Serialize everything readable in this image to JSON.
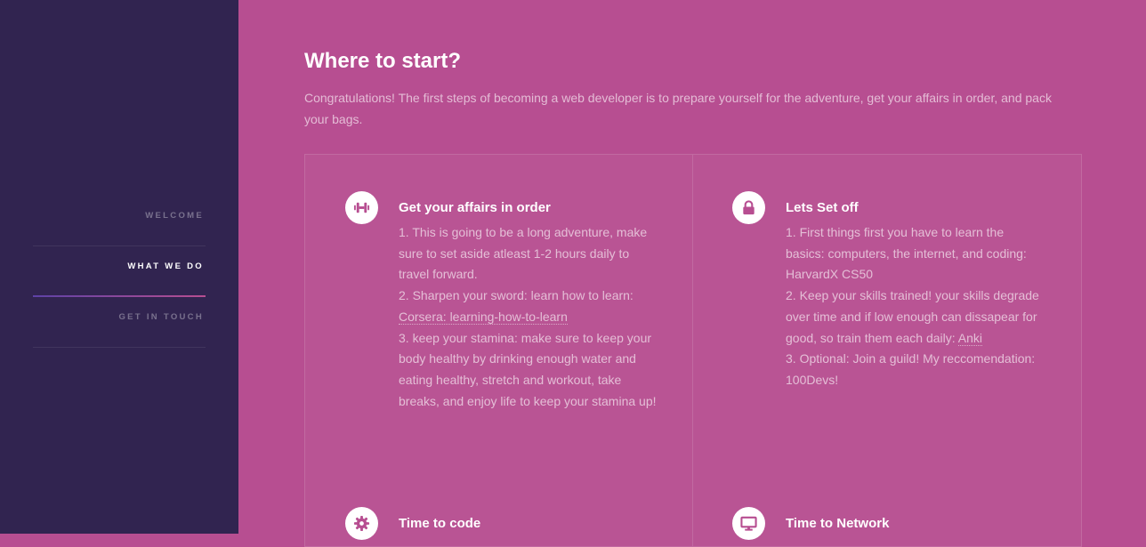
{
  "sidebar": {
    "nav": [
      {
        "label": "Welcome",
        "active": false
      },
      {
        "label": "What we do",
        "active": true
      },
      {
        "label": "Get in touch",
        "active": false
      }
    ]
  },
  "main": {
    "title": "Where to start?",
    "intro": "Congratulations! The first steps of becoming a web developer is to prepare yourself for the adventure, get your affairs in order, and pack your bags.",
    "features": [
      {
        "icon": "dumbbell-icon",
        "title": "Get your affairs in order",
        "lines": [
          {
            "text": "1. This is going to be a long adventure, make sure to set aside atleast 1-2 hours daily to travel forward."
          },
          {
            "text": "2. Sharpen your sword: learn how to learn: ",
            "link": "Corsera: learning-how-to-learn"
          },
          {
            "text": "3. keep your stamina: make sure to keep your body healthy by drinking enough water and eating healthy, stretch and workout, take breaks, and enjoy life to keep your stamina up!"
          }
        ]
      },
      {
        "icon": "lock-icon",
        "title": "Lets Set off",
        "lines": [
          {
            "text": "1. First things first you have to learn the basics: computers, the internet, and coding: HarvardX CS50"
          },
          {
            "text": "2. Keep your skills trained! your skills degrade over time and if low enough can dissapear for good, so train them each daily: ",
            "link": "Anki"
          },
          {
            "text": "3. Optional: Join a guild! My reccomendation: 100Devs!"
          }
        ]
      },
      {
        "icon": "gear-icon",
        "title": "Time to code",
        "lines": []
      },
      {
        "icon": "desktop-icon",
        "title": "Time to Network",
        "lines": []
      }
    ]
  },
  "colors": {
    "sidebar_bg": "#312450",
    "main_bg": "#b74e91",
    "accent_gradient_start": "#5e42a6",
    "accent_gradient_end": "#b74e91"
  }
}
